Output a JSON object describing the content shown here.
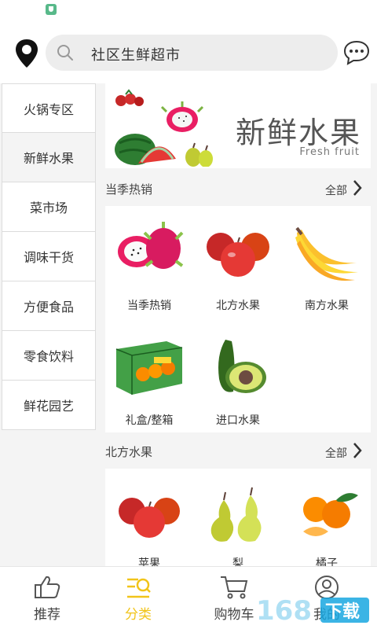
{
  "header": {
    "search_text": "社区生鲜超市"
  },
  "sidebar": {
    "items": [
      {
        "label": "火锅专区"
      },
      {
        "label": "新鲜水果"
      },
      {
        "label": "菜市场"
      },
      {
        "label": "调味干货"
      },
      {
        "label": "方便食品"
      },
      {
        "label": "零食饮料"
      },
      {
        "label": "鲜花园艺"
      }
    ],
    "active_index": 1
  },
  "banner": {
    "title": "新鲜水果",
    "subtitle": "Fresh fruit"
  },
  "section1": {
    "title": "当季热销",
    "more": "全部",
    "items": [
      {
        "label": "当季热销",
        "icon": "dragon-fruit"
      },
      {
        "label": "北方水果",
        "icon": "apples"
      },
      {
        "label": "南方水果",
        "icon": "bananas"
      },
      {
        "label": "礼盒/整箱",
        "icon": "orange-gift-box"
      },
      {
        "label": "进口水果",
        "icon": "avocado"
      }
    ]
  },
  "section2": {
    "title": "北方水果",
    "more": "全部",
    "items": [
      {
        "label": "苹果",
        "icon": "apples"
      },
      {
        "label": "梨",
        "icon": "pears"
      },
      {
        "label": "橘子",
        "icon": "tangerines"
      }
    ]
  },
  "tabbar": {
    "items": [
      {
        "label": "推荐",
        "icon": "thumbs-up-icon"
      },
      {
        "label": "分类",
        "icon": "category-search-icon"
      },
      {
        "label": "购物车",
        "icon": "cart-icon"
      },
      {
        "label": "我的",
        "icon": "user-icon"
      }
    ],
    "active_index": 1
  },
  "colors": {
    "accent": "#f1c419",
    "watermark": "#19a7e0"
  },
  "watermark": {
    "text": "168下载"
  }
}
